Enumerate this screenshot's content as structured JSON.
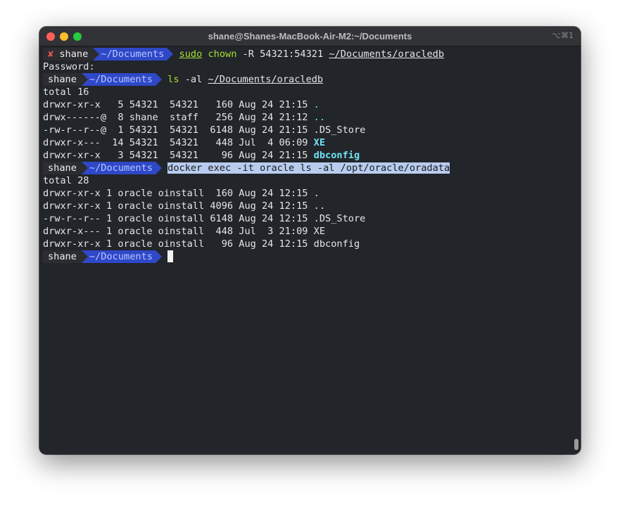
{
  "window": {
    "title": "shane@Shanes-MacBook-Air-M2:~/Documents",
    "shortcut": "⌥⌘1"
  },
  "prompt": {
    "error_mark": "✘",
    "user": "shane",
    "dir": "~/Documents"
  },
  "cmd1": {
    "sudo": "sudo",
    "chown": "chown",
    "args": " -R 54321:54321 ",
    "path": "~/Documents/oracledb"
  },
  "password_line": "Password:",
  "cmd2": {
    "ls": "ls",
    "args": " -al ",
    "path": "~/Documents/oracledb"
  },
  "listing1": {
    "total": "total 16",
    "rows": [
      {
        "meta": "drwxr-xr-x   5 54321  54321   160 Aug 24 21:15 ",
        "name": "."
      },
      {
        "meta": "drwx------@  8 shane  staff   256 Aug 24 21:12 ",
        "name": ".."
      },
      {
        "meta": "-rw-r--r--@  1 54321  54321  6148 Aug 24 21:15 ",
        "name": ".DS_Store"
      },
      {
        "meta": "drwxr-x---  14 54321  54321   448 Jul  4 06:09 ",
        "name": "XE"
      },
      {
        "meta": "drwxr-xr-x   3 54321  54321    96 Aug 24 21:15 ",
        "name": "dbconfig"
      }
    ]
  },
  "cmd3": "docker exec -it oracle ls -al /opt/oracle/oradata",
  "listing2": {
    "total": "total 28",
    "rows": [
      "drwxr-xr-x 1 oracle oinstall  160 Aug 24 12:15 .",
      "drwxr-xr-x 1 oracle oinstall 4096 Aug 24 12:15 ..",
      "-rw-r--r-- 1 oracle oinstall 6148 Aug 24 12:15 .DS_Store",
      "drwxr-x--- 1 oracle oinstall  448 Jul  3 21:09 XE",
      "drwxr-xr-x 1 oracle oinstall   96 Aug 24 12:15 dbconfig"
    ]
  },
  "colors": {
    "terminal_bg": "#22252a",
    "prompt_user_bg": "#2c2d31",
    "prompt_dir_bg": "#2f48c8",
    "command_green": "#a6e22e",
    "dir_cyan": "#6fe2f0",
    "selection": "#b8ccef"
  }
}
